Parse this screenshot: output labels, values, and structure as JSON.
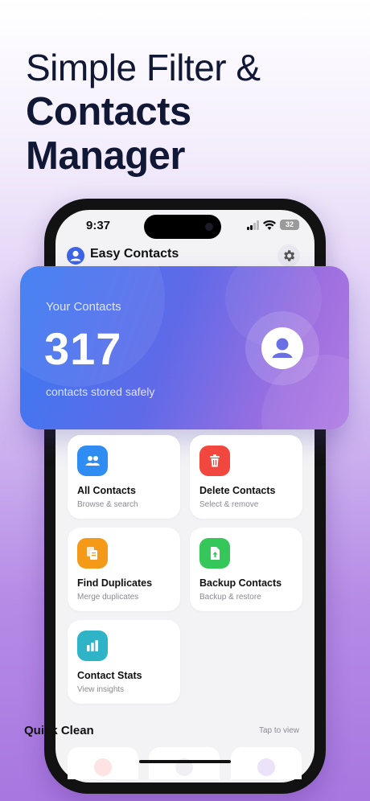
{
  "headline": {
    "line1": "Simple Filter &",
    "line2": "Contacts",
    "line3": "Manager"
  },
  "status_bar": {
    "time": "9:37",
    "battery": "32"
  },
  "app": {
    "title": "Easy Contacts"
  },
  "hero": {
    "label": "Your Contacts",
    "count": "317",
    "subtitle": "contacts stored safely"
  },
  "features": [
    {
      "title": "All Contacts",
      "subtitle": "Browse & search",
      "icon": "people-icon",
      "color": "#2f8cf2"
    },
    {
      "title": "Delete Contacts",
      "subtitle": "Select & remove",
      "icon": "trash-icon",
      "color": "#f2473f"
    },
    {
      "title": "Find Duplicates",
      "subtitle": "Merge duplicates",
      "icon": "duplicate-files-icon",
      "color": "#f59a18"
    },
    {
      "title": "Backup Contacts",
      "subtitle": "Backup & restore",
      "icon": "backup-upload-icon",
      "color": "#35c759"
    },
    {
      "title": "Contact Stats",
      "subtitle": "View insights",
      "icon": "bar-chart-icon",
      "color": "#2fb3c6"
    }
  ],
  "quick_clean": {
    "title": "Quick Clean",
    "link": "Tap to view"
  },
  "colors": {
    "headline": "#111836",
    "hero_start": "#3a7af3",
    "hero_end": "#b07be3"
  }
}
